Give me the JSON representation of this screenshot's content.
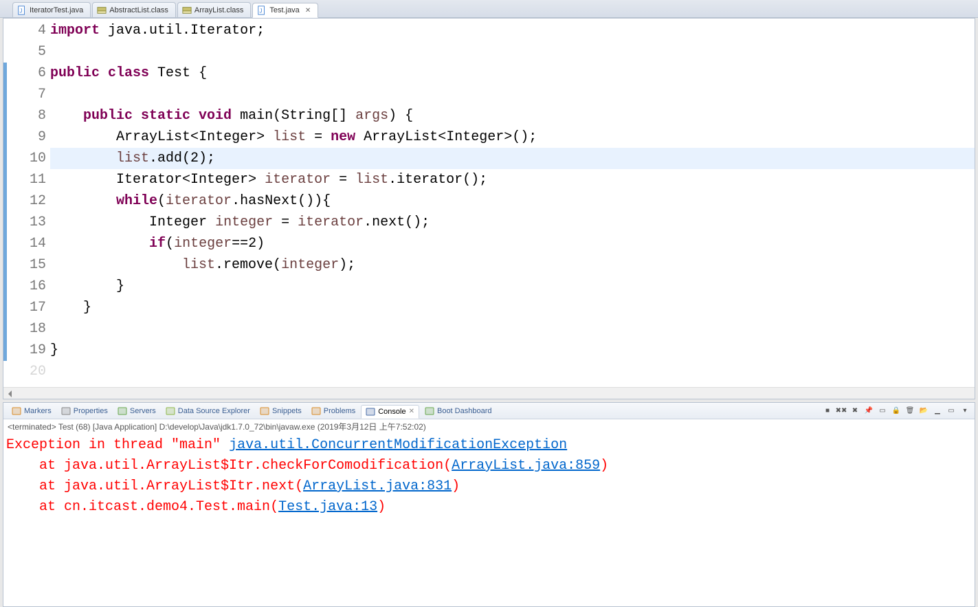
{
  "tabs": [
    {
      "label": "IteratorTest.java",
      "icon": "java"
    },
    {
      "label": "AbstractList.class",
      "icon": "class"
    },
    {
      "label": "ArrayList.class",
      "icon": "class"
    },
    {
      "label": "Test.java",
      "icon": "java",
      "active": true
    }
  ],
  "editor": {
    "first_line": 4,
    "highlight_line": 10,
    "tokens": [
      [
        [
          "kw",
          "import"
        ],
        [
          "punc",
          " "
        ],
        [
          "typ",
          "java.util.Iterator"
        ],
        [
          "punc",
          ";"
        ]
      ],
      [],
      [
        [
          "kw",
          "public class"
        ],
        [
          "punc",
          " "
        ],
        [
          "typ",
          "Test"
        ],
        [
          "punc",
          " {"
        ]
      ],
      [],
      [
        [
          "punc",
          "    "
        ],
        [
          "kw",
          "public static void"
        ],
        [
          "punc",
          " "
        ],
        [
          "typ",
          "main"
        ],
        [
          "punc",
          "("
        ],
        [
          "typ",
          "String"
        ],
        [
          "punc",
          "[] "
        ],
        [
          "var",
          "args"
        ],
        [
          "punc",
          ") {"
        ]
      ],
      [
        [
          "punc",
          "        "
        ],
        [
          "typ",
          "ArrayList"
        ],
        [
          "punc",
          "<"
        ],
        [
          "typ",
          "Integer"
        ],
        [
          "punc",
          "> "
        ],
        [
          "var",
          "list"
        ],
        [
          "punc",
          " = "
        ],
        [
          "kw",
          "new"
        ],
        [
          "punc",
          " "
        ],
        [
          "typ",
          "ArrayList"
        ],
        [
          "punc",
          "<"
        ],
        [
          "typ",
          "Integer"
        ],
        [
          "punc",
          ">();"
        ]
      ],
      [
        [
          "punc",
          "        "
        ],
        [
          "var",
          "list"
        ],
        [
          "punc",
          ".add(2);"
        ]
      ],
      [
        [
          "punc",
          "        "
        ],
        [
          "typ",
          "Iterator"
        ],
        [
          "punc",
          "<"
        ],
        [
          "typ",
          "Integer"
        ],
        [
          "punc",
          "> "
        ],
        [
          "var",
          "iterator"
        ],
        [
          "punc",
          " = "
        ],
        [
          "var",
          "list"
        ],
        [
          "punc",
          ".iterator();"
        ]
      ],
      [
        [
          "punc",
          "        "
        ],
        [
          "kw",
          "while"
        ],
        [
          "punc",
          "("
        ],
        [
          "var",
          "iterator"
        ],
        [
          "punc",
          ".hasNext()){"
        ]
      ],
      [
        [
          "punc",
          "            "
        ],
        [
          "typ",
          "Integer"
        ],
        [
          "punc",
          " "
        ],
        [
          "var",
          "integer"
        ],
        [
          "punc",
          " = "
        ],
        [
          "var",
          "iterator"
        ],
        [
          "punc",
          ".next();"
        ]
      ],
      [
        [
          "punc",
          "            "
        ],
        [
          "kw",
          "if"
        ],
        [
          "punc",
          "("
        ],
        [
          "var",
          "integer"
        ],
        [
          "punc",
          "==2)"
        ]
      ],
      [
        [
          "punc",
          "                "
        ],
        [
          "var",
          "list"
        ],
        [
          "punc",
          ".remove("
        ],
        [
          "var",
          "integer"
        ],
        [
          "punc",
          ");"
        ]
      ],
      [
        [
          "punc",
          "        }"
        ]
      ],
      [
        [
          "punc",
          "    }"
        ]
      ],
      [],
      [
        [
          "punc",
          "}"
        ]
      ]
    ]
  },
  "views": [
    {
      "label": "Markers",
      "icon": "markers"
    },
    {
      "label": "Properties",
      "icon": "props"
    },
    {
      "label": "Servers",
      "icon": "servers"
    },
    {
      "label": "Data Source Explorer",
      "icon": "dse"
    },
    {
      "label": "Snippets",
      "icon": "snippets"
    },
    {
      "label": "Problems",
      "icon": "problems"
    },
    {
      "label": "Console",
      "icon": "console",
      "active": true,
      "closable": true
    },
    {
      "label": "Boot Dashboard",
      "icon": "boot"
    }
  ],
  "console": {
    "status": "<terminated> Test (68) [Java Application] D:\\develop\\Java\\jdk1.7.0_72\\bin\\javaw.exe (2019年3月12日 上午7:52:02)",
    "lines": [
      {
        "segments": [
          [
            "err",
            "Exception in thread \"main\" "
          ],
          [
            "lnk",
            "java.util.ConcurrentModificationException"
          ]
        ]
      },
      {
        "segments": [
          [
            "err",
            "\tat java.util.ArrayList$Itr.checkForComodification("
          ],
          [
            "lnk",
            "ArrayList.java:859"
          ],
          [
            "err",
            ")"
          ]
        ]
      },
      {
        "segments": [
          [
            "err",
            "\tat java.util.ArrayList$Itr.next("
          ],
          [
            "lnk",
            "ArrayList.java:831"
          ],
          [
            "err",
            ")"
          ]
        ]
      },
      {
        "segments": [
          [
            "err",
            "\tat cn.itcast.demo4.Test.main("
          ],
          [
            "lnk",
            "Test.java:13"
          ],
          [
            "err",
            ")"
          ]
        ]
      }
    ]
  },
  "toolbar_icons": [
    "stop",
    "remove-all",
    "remove",
    "pin",
    "display",
    "scroll-lock",
    "clear",
    "open",
    "min",
    "max",
    "menu"
  ]
}
